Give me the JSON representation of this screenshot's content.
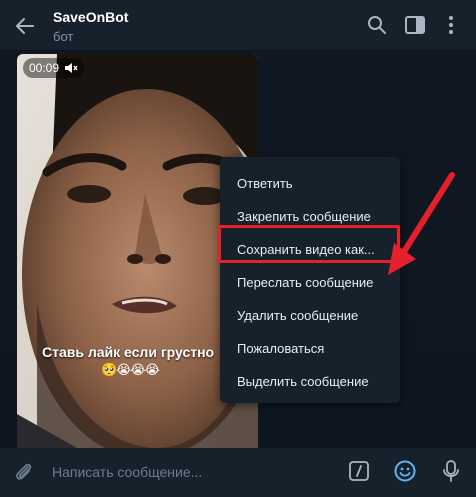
{
  "header": {
    "title": "SaveOnBot",
    "subtitle": "бот"
  },
  "video": {
    "duration": "00:09",
    "caption": "Ставь лайк если грустно",
    "caption_emojis": "🥺😭😭😭"
  },
  "context_menu": {
    "items": [
      {
        "label": "Ответить"
      },
      {
        "label": "Закрепить сообщение"
      },
      {
        "label": "Сохранить видео как..."
      },
      {
        "label": "Переслать сообщение"
      },
      {
        "label": "Удалить сообщение"
      },
      {
        "label": "Пожаловаться"
      },
      {
        "label": "Выделить сообщение"
      }
    ],
    "highlighted_index": 2
  },
  "composer": {
    "placeholder": "Написать сообщение..."
  },
  "icons": {
    "back": "arrow-left-icon",
    "search": "search-icon",
    "sidebar": "sidebar-toggle-icon",
    "more": "more-vertical-icon",
    "attach": "paperclip-icon",
    "commands": "bot-command-icon",
    "emoji": "smiley-icon",
    "mic": "microphone-icon",
    "mute": "speaker-muted-icon"
  },
  "colors": {
    "background": "#0e1621",
    "panel": "#17212b",
    "accent": "#5eb5f7",
    "annotation": "#e5202a"
  }
}
